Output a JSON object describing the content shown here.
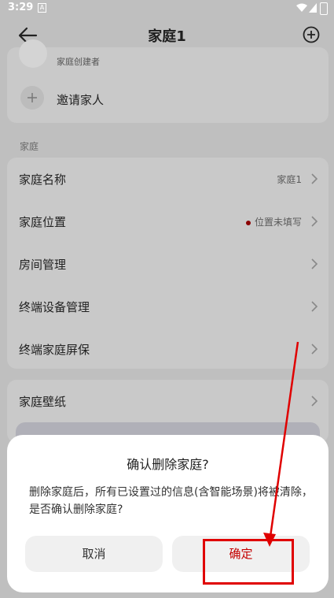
{
  "status_bar": {
    "time": "3:29",
    "notification_glyph": "A"
  },
  "header": {
    "title": "家庭1"
  },
  "members_card": {
    "creator_label": "家庭创建者",
    "invite_label": "邀请家人"
  },
  "home_section": {
    "title": "家庭",
    "rows": [
      {
        "label": "家庭名称",
        "value": "家庭1"
      },
      {
        "label": "家庭位置",
        "value": "位置未填写"
      },
      {
        "label": "房间管理",
        "value": ""
      },
      {
        "label": "终端设备管理",
        "value": ""
      },
      {
        "label": "终端家庭屏保",
        "value": ""
      }
    ]
  },
  "wallpaper_row": {
    "label": "家庭壁纸"
  },
  "dialog": {
    "title": "确认删除家庭?",
    "message": "删除家庭后，所有已设置过的信息(含智能场景)将被清除，是否确认删除家庭?",
    "cancel_label": "取消",
    "confirm_label": "确定"
  },
  "colors": {
    "overlay": "#bfbfbf",
    "accent_red": "#c40000",
    "annotation_red": "#e00000"
  },
  "icons": [
    "back-arrow-icon",
    "add-circle-icon",
    "plus-icon",
    "chevron-right-icon",
    "wifi-icon",
    "signal-icon",
    "battery-icon"
  ]
}
